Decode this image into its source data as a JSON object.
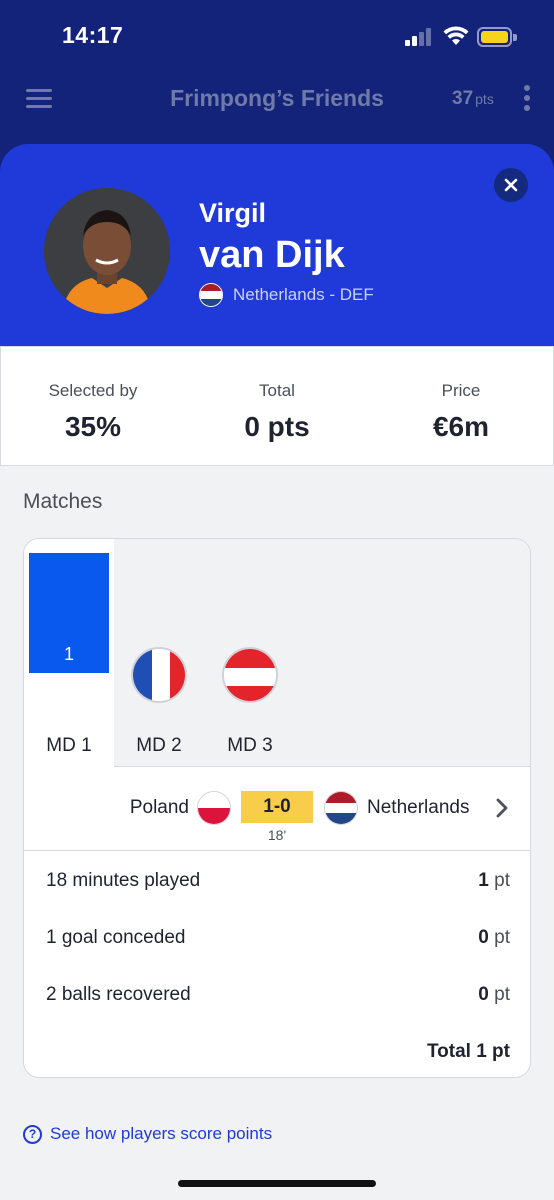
{
  "status_bar": {
    "time": "14:17"
  },
  "app_bar": {
    "league_name": "Frimpong’s Friends",
    "points_value": "37",
    "points_unit": "pts",
    "menu_icon": "hamburger-icon",
    "more_icon": "more-vertical-icon"
  },
  "player": {
    "first_name": "Virgil",
    "last_name": "van Dijk",
    "nation_position": "Netherlands - DEF",
    "flag_colors": [
      "#ae1c28",
      "#ffffff",
      "#21468b"
    ],
    "header_color": "#1f3ad9"
  },
  "stats": [
    {
      "label": "Selected by",
      "value": "35%"
    },
    {
      "label": "Total",
      "value": "0 pts"
    },
    {
      "label": "Price",
      "value": "€6m"
    }
  ],
  "matches": {
    "title": "Matches",
    "tabs": [
      {
        "label": "MD 1",
        "points": "1",
        "active": true
      },
      {
        "label": "MD 2",
        "opponent_flag": "france-flag-icon"
      },
      {
        "label": "MD 3",
        "opponent_flag": "austria-flag-icon"
      }
    ],
    "fixture": {
      "home_team": "Poland",
      "away_team": "Netherlands",
      "score": "1-0",
      "minute": "18'"
    },
    "breakdown": [
      {
        "description": "18 minutes played",
        "points": "1",
        "unit": "pt"
      },
      {
        "description": "1 goal conceded",
        "points": "0",
        "unit": "pt"
      },
      {
        "description": "2 balls recovered",
        "points": "0",
        "unit": "pt"
      }
    ],
    "total": "Total 1 pt"
  },
  "help_link": "See how players score points"
}
